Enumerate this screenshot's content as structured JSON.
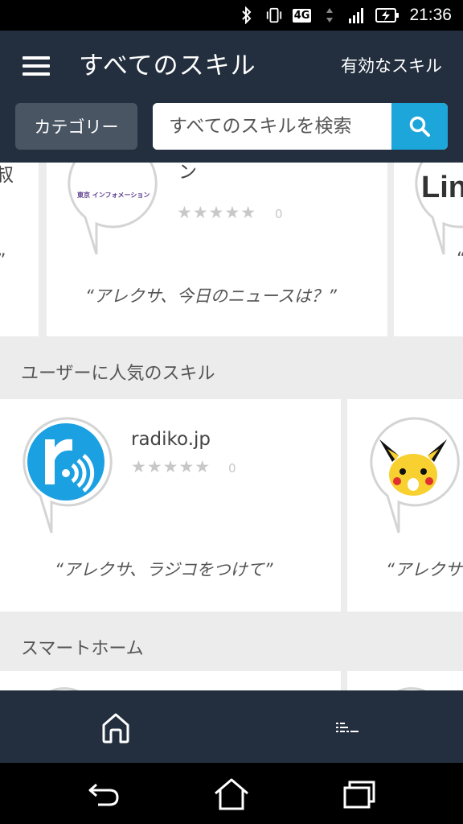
{
  "status_bar": {
    "network": "4G",
    "time": "21:36"
  },
  "app_bar": {
    "title": "すべてのスキル",
    "enabled_skills_link": "有効なスキル",
    "category_button": "カテゴリー",
    "search_placeholder": "すべてのスキルを検索"
  },
  "top_row": {
    "left_card": {
      "title_partial": "叔",
      "phrase_partial": "”"
    },
    "center_card": {
      "logo_text": "東京 インフォメーション",
      "name": "東京インフォメーション",
      "rating": 0,
      "rating_count": "0",
      "phrase": "“アレクサ、今日のニュースは？”"
    },
    "right_card": {
      "logo_text": "Lin",
      "phrase_partial": "“"
    }
  },
  "sections": [
    {
      "title": "ユーザーに人気のスキル",
      "cards": [
        {
          "name": "radiko.jp",
          "rating": 0,
          "rating_count": "0",
          "phrase": "“アレクサ、ラジコをつけて”"
        },
        {
          "phrase_partial": "“アレクサ"
        }
      ]
    },
    {
      "title": "スマートホーム"
    }
  ],
  "colors": {
    "app_bar": "#232f3e",
    "search_button": "#1da6d9",
    "category_button": "#4a5563",
    "radiko_blue": "#1ba1e2",
    "pikachu_yellow": "#f8d030"
  }
}
